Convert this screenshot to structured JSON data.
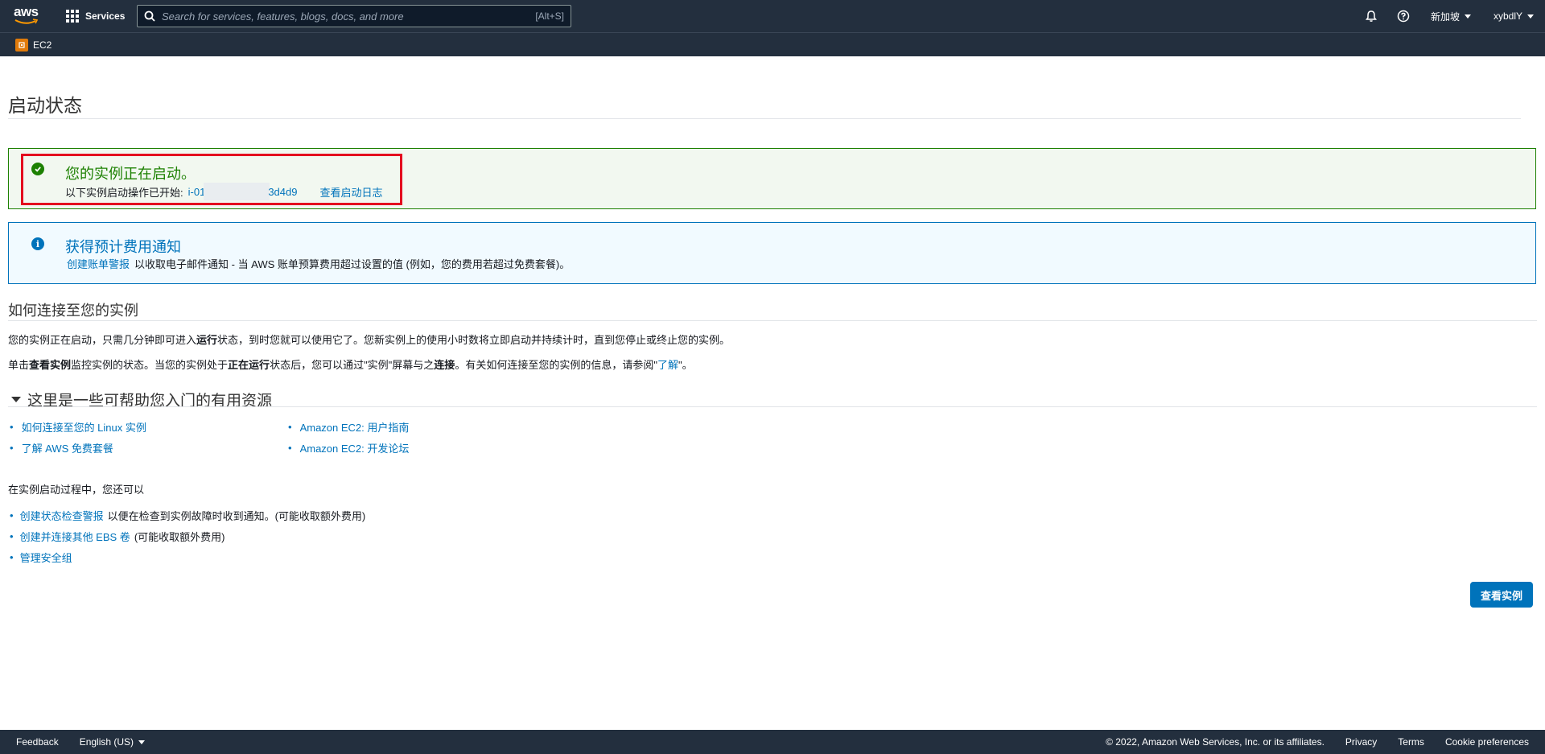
{
  "topnav": {
    "logo_text": "aws",
    "services_label": "Services",
    "search_placeholder": "Search for services, features, blogs, docs, and more",
    "search_shortcut": "[Alt+S]",
    "region_label": "新加坡",
    "account_label": "xybdlY"
  },
  "subnav": {
    "service_label": "EC2"
  },
  "page": {
    "title": "启动状态",
    "success": {
      "heading": "您的实例正在启动。",
      "prefix": "以下实例启动操作已开始:",
      "instance_id_start": "i-01",
      "instance_id_end": "3d4d9",
      "log_link": "查看启动日志"
    },
    "info": {
      "heading": "获得预计费用通知",
      "link": "创建账单警报",
      "text": "以收取电子邮件通知 - 当 AWS 账单预算费用超过设置的值 (例如，您的费用若超过免费套餐)。"
    },
    "connect": {
      "title": "如何连接至您的实例",
      "p1_a": "您的实例正在启动，只需几分钟即可进入",
      "p1_b": "运行",
      "p1_c": "状态，到时您就可以使用它了。您新实例上的使用小时数将立即启动并持续计时，直到您停止或终止您的实例。",
      "p2_a": "单击",
      "p2_b": "查看实例",
      "p2_c": "监控实例的状态。当您的实例处于",
      "p2_d": "正在运行",
      "p2_e": "状态后，您可以通过\"实例\"屏幕与之",
      "p2_f": "连接",
      "p2_g": "。有关如何连接至您的实例的信息，请参阅\"",
      "p2_link": "了解",
      "p2_h": "\"。"
    },
    "resources": {
      "title": "这里是一些可帮助您入门的有用资源",
      "col1": [
        "如何连接至您的 Linux 实例",
        "了解 AWS 免费套餐"
      ],
      "col2": [
        "Amazon EC2: 用户指南",
        "Amazon EC2: 开发论坛"
      ]
    },
    "during": {
      "title": "在实例启动过程中，您还可以",
      "items": [
        {
          "link": "创建状态检查警报",
          "text": "以便在检查到实例故障时收到通知。(可能收取额外费用)"
        },
        {
          "link": "创建并连接其他 EBS 卷",
          "text": "(可能收取额外费用)"
        },
        {
          "link": "管理安全组",
          "text": ""
        }
      ]
    },
    "view_instances_button": "查看实例"
  },
  "footer": {
    "feedback": "Feedback",
    "language": "English (US)",
    "copyright": "© 2022, Amazon Web Services, Inc. or its affiliates.",
    "privacy": "Privacy",
    "terms": "Terms",
    "cookies": "Cookie preferences"
  },
  "colors": {
    "nav_bg": "#232f3e",
    "link": "#0073bb",
    "success": "#1d8102",
    "highlight": "#e4061f"
  }
}
